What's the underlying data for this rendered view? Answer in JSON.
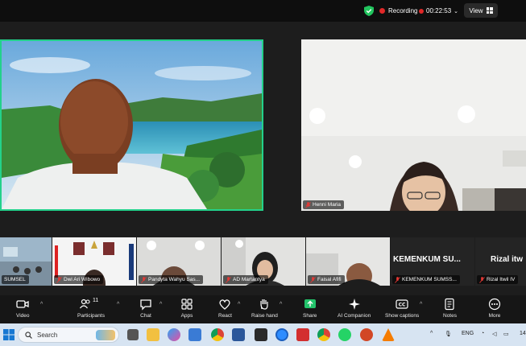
{
  "topbar": {
    "recording_label": "Recording",
    "timer": "00:22:53",
    "view_label": "View",
    "security_icon": "shield-check-icon"
  },
  "participants": {
    "speaker": {
      "name": ""
    },
    "remote": {
      "name": "Henni Maria"
    },
    "thumbnails": [
      {
        "name": "SUMSEL",
        "muted": false
      },
      {
        "name": "Dwi  Ari  Wibowo",
        "muted": true
      },
      {
        "name": "Pandyta Wahyu Sas...",
        "muted": true
      },
      {
        "name": "AD Martantya",
        "muted": true
      },
      {
        "name": "Faisal Afifi",
        "muted": true
      },
      {
        "name": "KEMENKUM SUMSS...",
        "muted": true,
        "display_text": "KEMENKUM  SU..."
      },
      {
        "name": "Rizal Itwil IV",
        "muted": true,
        "display_text": "Rizal  itw"
      }
    ]
  },
  "toolbar": {
    "items": [
      {
        "label": "Video",
        "icon": "video-camera-icon"
      },
      {
        "label": "Participants",
        "icon": "participants-icon",
        "count": "11"
      },
      {
        "label": "Chat",
        "icon": "chat-icon"
      },
      {
        "label": "Apps",
        "icon": "apps-icon"
      },
      {
        "label": "React",
        "icon": "heart-icon"
      },
      {
        "label": "Raise hand",
        "icon": "hand-icon"
      },
      {
        "label": "Share",
        "icon": "share-screen-icon"
      },
      {
        "label": "AI Companion",
        "icon": "sparkle-icon"
      },
      {
        "label": "Show captions",
        "icon": "captions-icon"
      },
      {
        "label": "Notes",
        "icon": "notes-icon"
      },
      {
        "label": "More",
        "icon": "more-icon"
      }
    ]
  },
  "taskbar": {
    "search_placeholder": "Search",
    "language": "ENG",
    "clock": "14"
  },
  "colors": {
    "accent": "#23d18b",
    "record": "#e02828",
    "share": "#23c36b"
  }
}
